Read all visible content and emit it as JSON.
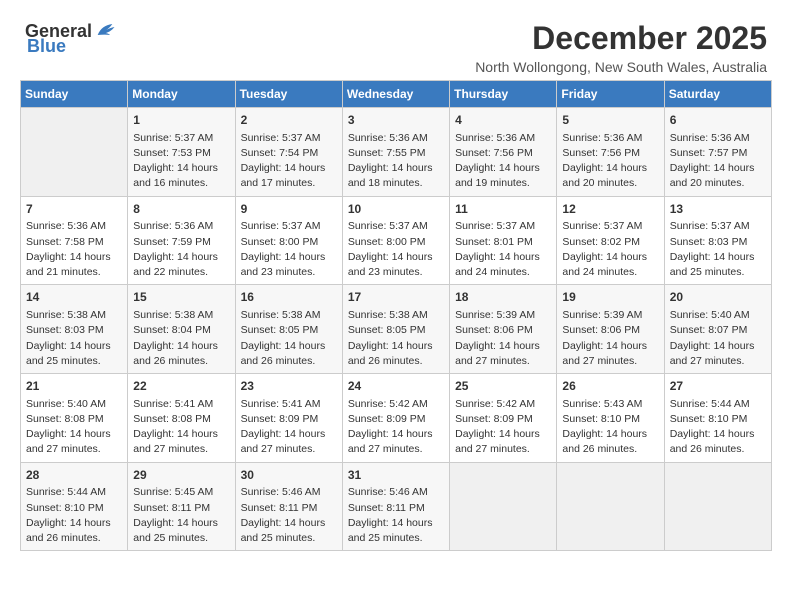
{
  "header": {
    "logo_general": "General",
    "logo_blue": "Blue",
    "month": "December 2025",
    "location": "North Wollongong, New South Wales, Australia"
  },
  "days_of_week": [
    "Sunday",
    "Monday",
    "Tuesday",
    "Wednesday",
    "Thursday",
    "Friday",
    "Saturday"
  ],
  "weeks": [
    [
      {
        "day": "",
        "info": ""
      },
      {
        "day": "1",
        "info": "Sunrise: 5:37 AM\nSunset: 7:53 PM\nDaylight: 14 hours\nand 16 minutes."
      },
      {
        "day": "2",
        "info": "Sunrise: 5:37 AM\nSunset: 7:54 PM\nDaylight: 14 hours\nand 17 minutes."
      },
      {
        "day": "3",
        "info": "Sunrise: 5:36 AM\nSunset: 7:55 PM\nDaylight: 14 hours\nand 18 minutes."
      },
      {
        "day": "4",
        "info": "Sunrise: 5:36 AM\nSunset: 7:56 PM\nDaylight: 14 hours\nand 19 minutes."
      },
      {
        "day": "5",
        "info": "Sunrise: 5:36 AM\nSunset: 7:56 PM\nDaylight: 14 hours\nand 20 minutes."
      },
      {
        "day": "6",
        "info": "Sunrise: 5:36 AM\nSunset: 7:57 PM\nDaylight: 14 hours\nand 20 minutes."
      }
    ],
    [
      {
        "day": "7",
        "info": "Sunrise: 5:36 AM\nSunset: 7:58 PM\nDaylight: 14 hours\nand 21 minutes."
      },
      {
        "day": "8",
        "info": "Sunrise: 5:36 AM\nSunset: 7:59 PM\nDaylight: 14 hours\nand 22 minutes."
      },
      {
        "day": "9",
        "info": "Sunrise: 5:37 AM\nSunset: 8:00 PM\nDaylight: 14 hours\nand 23 minutes."
      },
      {
        "day": "10",
        "info": "Sunrise: 5:37 AM\nSunset: 8:00 PM\nDaylight: 14 hours\nand 23 minutes."
      },
      {
        "day": "11",
        "info": "Sunrise: 5:37 AM\nSunset: 8:01 PM\nDaylight: 14 hours\nand 24 minutes."
      },
      {
        "day": "12",
        "info": "Sunrise: 5:37 AM\nSunset: 8:02 PM\nDaylight: 14 hours\nand 24 minutes."
      },
      {
        "day": "13",
        "info": "Sunrise: 5:37 AM\nSunset: 8:03 PM\nDaylight: 14 hours\nand 25 minutes."
      }
    ],
    [
      {
        "day": "14",
        "info": "Sunrise: 5:38 AM\nSunset: 8:03 PM\nDaylight: 14 hours\nand 25 minutes."
      },
      {
        "day": "15",
        "info": "Sunrise: 5:38 AM\nSunset: 8:04 PM\nDaylight: 14 hours\nand 26 minutes."
      },
      {
        "day": "16",
        "info": "Sunrise: 5:38 AM\nSunset: 8:05 PM\nDaylight: 14 hours\nand 26 minutes."
      },
      {
        "day": "17",
        "info": "Sunrise: 5:38 AM\nSunset: 8:05 PM\nDaylight: 14 hours\nand 26 minutes."
      },
      {
        "day": "18",
        "info": "Sunrise: 5:39 AM\nSunset: 8:06 PM\nDaylight: 14 hours\nand 27 minutes."
      },
      {
        "day": "19",
        "info": "Sunrise: 5:39 AM\nSunset: 8:06 PM\nDaylight: 14 hours\nand 27 minutes."
      },
      {
        "day": "20",
        "info": "Sunrise: 5:40 AM\nSunset: 8:07 PM\nDaylight: 14 hours\nand 27 minutes."
      }
    ],
    [
      {
        "day": "21",
        "info": "Sunrise: 5:40 AM\nSunset: 8:08 PM\nDaylight: 14 hours\nand 27 minutes."
      },
      {
        "day": "22",
        "info": "Sunrise: 5:41 AM\nSunset: 8:08 PM\nDaylight: 14 hours\nand 27 minutes."
      },
      {
        "day": "23",
        "info": "Sunrise: 5:41 AM\nSunset: 8:09 PM\nDaylight: 14 hours\nand 27 minutes."
      },
      {
        "day": "24",
        "info": "Sunrise: 5:42 AM\nSunset: 8:09 PM\nDaylight: 14 hours\nand 27 minutes."
      },
      {
        "day": "25",
        "info": "Sunrise: 5:42 AM\nSunset: 8:09 PM\nDaylight: 14 hours\nand 27 minutes."
      },
      {
        "day": "26",
        "info": "Sunrise: 5:43 AM\nSunset: 8:10 PM\nDaylight: 14 hours\nand 26 minutes."
      },
      {
        "day": "27",
        "info": "Sunrise: 5:44 AM\nSunset: 8:10 PM\nDaylight: 14 hours\nand 26 minutes."
      }
    ],
    [
      {
        "day": "28",
        "info": "Sunrise: 5:44 AM\nSunset: 8:10 PM\nDaylight: 14 hours\nand 26 minutes."
      },
      {
        "day": "29",
        "info": "Sunrise: 5:45 AM\nSunset: 8:11 PM\nDaylight: 14 hours\nand 25 minutes."
      },
      {
        "day": "30",
        "info": "Sunrise: 5:46 AM\nSunset: 8:11 PM\nDaylight: 14 hours\nand 25 minutes."
      },
      {
        "day": "31",
        "info": "Sunrise: 5:46 AM\nSunset: 8:11 PM\nDaylight: 14 hours\nand 25 minutes."
      },
      {
        "day": "",
        "info": ""
      },
      {
        "day": "",
        "info": ""
      },
      {
        "day": "",
        "info": ""
      }
    ]
  ]
}
